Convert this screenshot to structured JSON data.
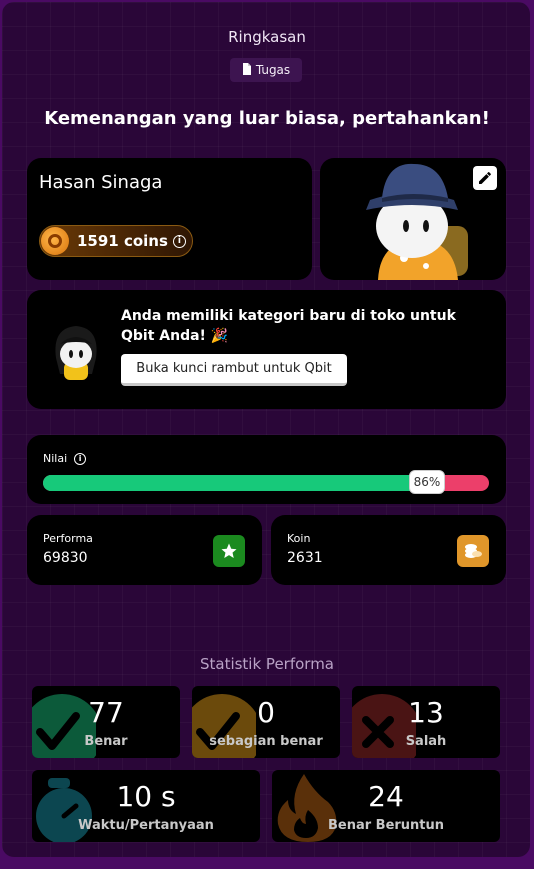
{
  "header": {
    "title": "Ringkasan",
    "tag_label": "Tugas"
  },
  "headline": "Kemenangan yang luar biasa, pertahankan!",
  "profile": {
    "name": "Hasan Sinaga",
    "coins_label": "1591 coins"
  },
  "promo": {
    "text": "Anda memiliki kategori baru di toko untuk Qbit Anda! 🎉",
    "button_label": "Buka kunci rambut untuk Qbit"
  },
  "score": {
    "label": "Nilai",
    "percent_label": "86%",
    "percent": 86
  },
  "stats": {
    "performa_label": "Performa",
    "performa_value": "69830",
    "koin_label": "Koin",
    "koin_value": "2631"
  },
  "performance": {
    "title": "Statistik Performa",
    "tiles": [
      {
        "value": "77",
        "label": "Benar"
      },
      {
        "value": "0",
        "label": "sebagian benar"
      },
      {
        "value": "13",
        "label": "Salah"
      },
      {
        "value": "10 s",
        "label": "Waktu/Pertanyaan"
      },
      {
        "value": "24",
        "label": "Benar Beruntun"
      }
    ]
  },
  "colors": {
    "correct": "#0c5a3a",
    "partial": "#6b4a0c",
    "wrong": "#4a1414",
    "timer": "#0c4650",
    "streak": "#5a300a",
    "bar_fill": "#17c97a",
    "bar_track": "#ec3f6a",
    "performa_icon": "#1b8a1f",
    "koin_icon": "#e0962a"
  },
  "icons": {
    "tag": "document-icon",
    "coin": "coin-icon",
    "info": "info-icon",
    "edit": "pencil-icon",
    "performa": "star-icon",
    "koin": "coin-stack-icon",
    "correct": "check-icon",
    "wrong": "cross-icon",
    "timer": "stopwatch-icon",
    "streak": "flame-icon"
  }
}
